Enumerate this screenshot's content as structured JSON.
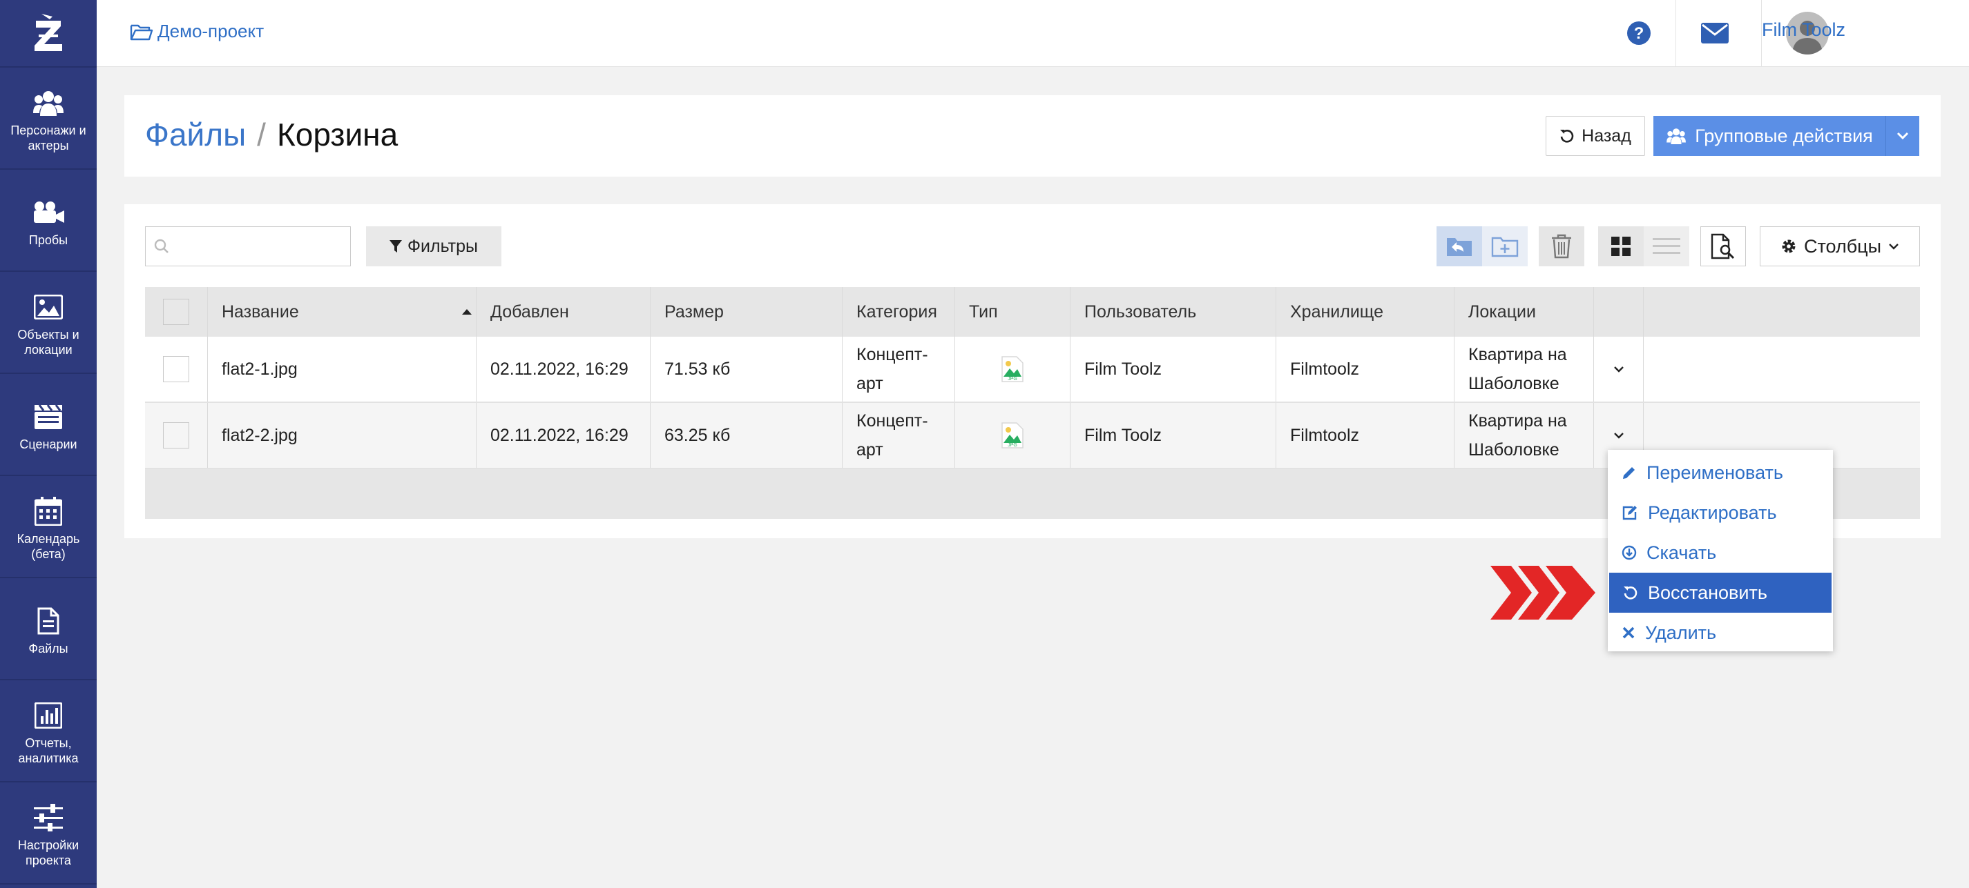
{
  "sidebar": {
    "logo_icon": "z-logo",
    "items": [
      {
        "label": "Персонажи и актеры",
        "icon": "users-icon"
      },
      {
        "label": "Пробы",
        "icon": "video-camera-icon"
      },
      {
        "label": "Объекты и локации",
        "icon": "image-icon"
      },
      {
        "label": "Сценарии",
        "icon": "clapperboard-icon"
      },
      {
        "label": "Календарь (бета)",
        "icon": "calendar-icon"
      },
      {
        "label": "Файлы",
        "icon": "file-icon"
      },
      {
        "label": "Отчеты, аналитика",
        "icon": "bar-chart-icon"
      },
      {
        "label": "Настройки проекта",
        "icon": "sliders-icon"
      }
    ]
  },
  "topbar": {
    "project": "Демо-проект",
    "user_name": "Film Toolz"
  },
  "header": {
    "breadcrumb_root": "Файлы",
    "separator": "/",
    "current": "Корзина",
    "back_label": "Назад",
    "group_actions_label": "Групповые действия"
  },
  "toolbar": {
    "search_placeholder": "",
    "filters_label": "Фильтры",
    "columns_label": "Столбцы"
  },
  "table": {
    "columns": [
      "Название",
      "Добавлен",
      "Размер",
      "Категория",
      "Тип",
      "Пользователь",
      "Хранилище",
      "Локации"
    ],
    "rows": [
      {
        "name": "flat2-1.jpg",
        "added": "02.11.2022, 16:29",
        "size": "71.53 кб",
        "category_1": "Концепт-",
        "category_2": "арт",
        "type": "JPG",
        "user": "Film Toolz",
        "storage": "Filmtoolz",
        "location_1": "Квартира на",
        "location_2": "Шаболовке"
      },
      {
        "name": "flat2-2.jpg",
        "added": "02.11.2022, 16:29",
        "size": "63.25 кб",
        "category_1": "Концепт-",
        "category_2": "арт",
        "type": "JPG",
        "user": "Film Toolz",
        "storage": "Filmtoolz",
        "location_1": "Квартира на",
        "location_2": "Шаболовке"
      }
    ]
  },
  "context_menu": {
    "items": [
      {
        "label": "Переименовать",
        "icon": "pencil-icon"
      },
      {
        "label": "Редактировать",
        "icon": "edit-icon"
      },
      {
        "label": "Скачать",
        "icon": "download-icon"
      },
      {
        "label": "Восстановить",
        "icon": "restore-icon",
        "active": true
      },
      {
        "label": "Удалить",
        "icon": "close-icon"
      }
    ]
  },
  "colors": {
    "sidebar": "#2e3a7d",
    "accent": "#2f6fc6",
    "button_primary": "#5b8fe6",
    "menu_active": "#2f62c0",
    "pointer_arrow": "#e32626"
  }
}
